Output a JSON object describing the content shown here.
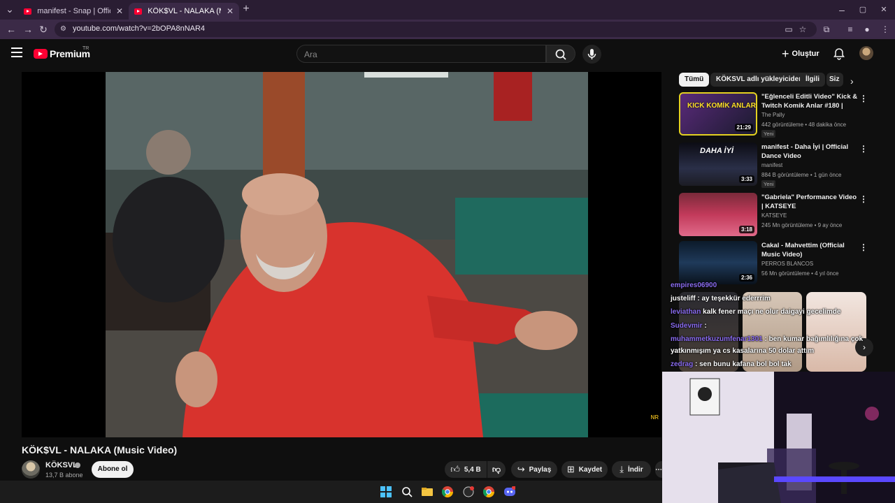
{
  "browser": {
    "tabs": [
      {
        "title": "manifest - Snap | Official Dance",
        "active": false
      },
      {
        "title": "KÖK$VL - NALAKA (Music Video",
        "active": true
      }
    ],
    "url": "youtube.com/watch?v=2bOPA8nNAR4",
    "new_tab_label": "+",
    "close_label": "✕"
  },
  "header": {
    "logo_word": "Premium",
    "country": "TR",
    "search_placeholder": "Ara",
    "create_label": "Oluştur"
  },
  "video": {
    "title": "KÖK$VL - NALAKA (Music Video)",
    "channel": "KÖKSVL",
    "subscribers": "13,7 B abone",
    "subscribe_label": "Abone ol",
    "likes": "5,4 B",
    "share_label": "Paylaş",
    "save_label": "Kaydet",
    "download_label": "İndir"
  },
  "chips": [
    "Tümü",
    "KÖKSVL adlı yükleyiciden",
    "İlgili",
    "Siz"
  ],
  "recommendations": [
    {
      "title": "\"Eğlenceli Editli Video\" Kick & Twitch Komik Anlar #180 | The...",
      "channel": "The Pally",
      "meta": "442 görüntüleme • 48 dakika önce",
      "badge": "Yeni",
      "duration": "21:29",
      "thumb_text": "KICK KOMİK ANLAR"
    },
    {
      "title": "manifest - Daha İyi | Official Dance Video",
      "channel": "manifest",
      "meta": "884 B görüntüleme • 1 gün önce",
      "badge": "Yeni",
      "duration": "3:33",
      "thumb_text": "DAHA İYİ"
    },
    {
      "title": "\"Gabriela\" Performance Video | KATSEYE",
      "channel": "KATSEYE",
      "meta": "245 Mn görüntüleme • 9 ay önce",
      "badge": "",
      "duration": "3:18",
      "thumb_text": ""
    },
    {
      "title": "Cakal - Mahvettim (Official Music Video)",
      "channel": "PERROS BLANCOS",
      "meta": "56 Mn görüntüleme • 4 yıl önce",
      "badge": "",
      "duration": "2:36",
      "thumb_text": ""
    }
  ],
  "chat": [
    {
      "user": "empires06900",
      "text": ""
    },
    {
      "user": "justeliff",
      "text": ": ay teşekkür ederrrim"
    },
    {
      "user": "leviathan",
      "text": "kalk fener maçı ne olur daigayi gecelimde"
    },
    {
      "user": "Sudevmir",
      "text": ":"
    },
    {
      "user": "muhammetkuzumfenar1301",
      "text": ": ben kumar bağımlılığına çok"
    },
    {
      "user": "",
      "text": "yatkınmışım ya cs kasalarına 50 dolar attım"
    },
    {
      "user": "zedrag",
      "text": ": sen bunu kafana bol bol tak"
    }
  ],
  "colors": {
    "accent": "#ff0033",
    "browser_chrome": "#2a1d33",
    "chat_user": "#8a6cf0"
  }
}
